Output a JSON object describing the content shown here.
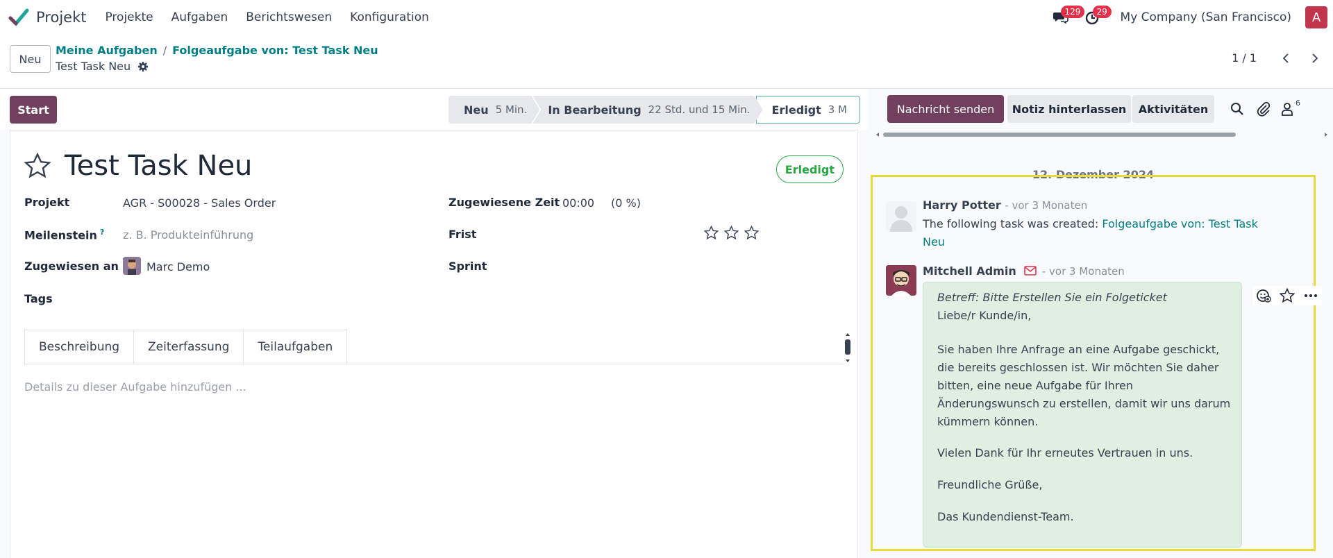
{
  "app": {
    "name": "Projekt",
    "menu": [
      "Projekte",
      "Aufgaben",
      "Berichtswesen",
      "Konfiguration"
    ],
    "messages_badge": "129",
    "activities_badge": "29",
    "company": "My Company (San Francisco)",
    "user_initial": "A"
  },
  "control": {
    "new_button": "Neu",
    "breadcrumb": [
      "Meine Aufgaben",
      "Folgeaufgabe von: Test Task Neu"
    ],
    "current": "Test Task Neu",
    "pager": "1 / 1"
  },
  "statusbar": {
    "start_button": "Start",
    "stages": [
      {
        "name": "Neu",
        "duration": "5 Min."
      },
      {
        "name": "In Bearbeitung",
        "duration": "22 Std. und 15 Min."
      },
      {
        "name": "Erledigt",
        "duration": "3 M"
      }
    ]
  },
  "task": {
    "title": "Test Task Neu",
    "state": "Erledigt",
    "labels": {
      "project": "Projekt",
      "milestone": "Meilenstein",
      "milestone_help": "?",
      "assigned": "Zugewiesen an",
      "tags": "Tags",
      "allocated": "Zugewiesene Zeit",
      "deadline": "Frist",
      "sprint": "Sprint"
    },
    "project": "AGR - S00028 - Sales Order",
    "milestone_placeholder": "z. B. Produkteinführung",
    "assignee": "Marc Demo",
    "allocated_time": "00:00",
    "allocated_percent": "(0 %)",
    "priority_stars": 3,
    "tabs": [
      "Beschreibung",
      "Zeiterfassung",
      "Teilaufgaben"
    ],
    "description_placeholder": "Details zu dieser Aufgabe hinzufügen ..."
  },
  "chatter": {
    "send_message": "Nachricht senden",
    "log_note": "Notiz hinterlassen",
    "activities": "Aktivitäten",
    "followers_count": "6",
    "date": "12. Dezember 2024",
    "messages": [
      {
        "author": "Harry Potter",
        "when": "- vor 3 Monaten",
        "text": "The following task was created:",
        "link": "Folgeaufgabe von: Test Task Neu"
      },
      {
        "author": "Mitchell Admin",
        "when": "- vor 3 Monaten",
        "subject": "Betreff: Bitte Erstellen Sie ein Folgeticket",
        "greeting": "Liebe/r Kunde/in,",
        "body": "Sie haben Ihre Anfrage an eine Aufgabe geschickt, die bereits geschlossen ist. Wir möchten Sie daher bitten, eine neue Aufgabe für Ihren Änderungswunsch zu erstellen, damit wir uns darum kümmern können.",
        "thanks": "Vielen Dank für Ihr erneutes Vertrauen in uns.",
        "closing": "Freundliche Grüße,",
        "signature": "Das Kundendienst-Team."
      }
    ]
  },
  "colors": {
    "primary": "#71405f",
    "link": "#017e84",
    "success": "#28a745",
    "highlight": "#e8dc3a"
  }
}
